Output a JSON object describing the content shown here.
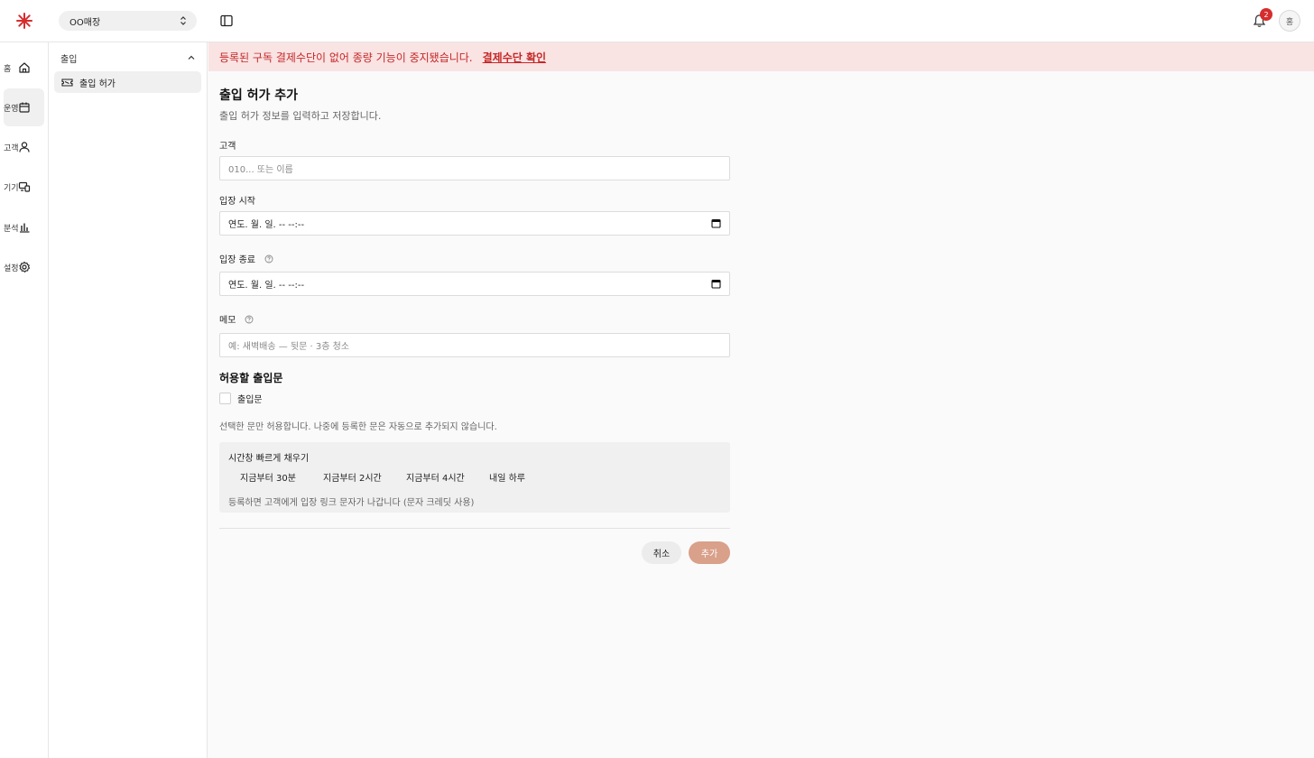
{
  "header": {
    "store_name": "OO매장",
    "notification_count": "2",
    "avatar_initial": "홍"
  },
  "rail": {
    "items": [
      {
        "label": "홈",
        "icon": "home-icon"
      },
      {
        "label": "운영",
        "icon": "calendar-icon"
      },
      {
        "label": "고객",
        "icon": "user-icon"
      },
      {
        "label": "기기",
        "icon": "devices-icon"
      },
      {
        "label": "분석",
        "icon": "bar-chart-icon"
      },
      {
        "label": "설정",
        "icon": "gear-icon"
      }
    ],
    "active_index": 1
  },
  "subnav": {
    "group_label": "출입",
    "items": [
      {
        "label": "출입 허가",
        "icon": "ticket-icon"
      }
    ]
  },
  "banner": {
    "message": "등록된 구독 결제수단이 없어 종량 기능이 중지됐습니다.",
    "link_label": "결제수단 확인"
  },
  "form": {
    "title": "출입 허가 추가",
    "subtitle": "출입 허가 정보를 입력하고 저장합니다.",
    "customer": {
      "label": "고객",
      "placeholder": "010... 또는 이름"
    },
    "start": {
      "label": "입장 시작",
      "value": "연도. 월. 일. -- --:--"
    },
    "end": {
      "label": "입장 종료",
      "value": "연도. 월. 일. -- --:--"
    },
    "memo": {
      "label": "메모",
      "placeholder": "예: 새벽배송 — 뒷문 · 3층 청소"
    },
    "doors": {
      "title": "허용할 출입문",
      "option_label": "출입문",
      "hint": "선택한 문만 허용합니다. 나중에 등록한 문은 자동으로 추가되지 않습니다."
    },
    "quick": {
      "title": "시간창 빠르게 채우기",
      "buttons": [
        "지금부터 30분",
        "지금부터 2시간",
        "지금부터 4시간",
        "내일 하루"
      ],
      "note": "등록하면 고객에게 입장 링크 문자가 나갑니다 (문자 크레딧 사용)"
    },
    "cancel_label": "취소",
    "submit_label": "추가"
  },
  "colors": {
    "accent": "#d9a08a",
    "banner_bg": "#f9e3e3",
    "banner_text": "#c62828",
    "logo": "#d62d2d"
  }
}
